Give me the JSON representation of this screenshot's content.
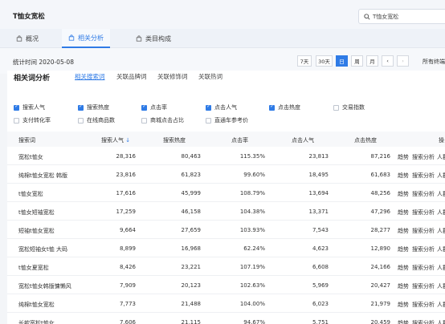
{
  "app": {
    "title": "T恤女宽松"
  },
  "search": {
    "value": "T恤女宽松"
  },
  "nav_tabs": [
    {
      "label": "概况",
      "icon": "shopping-bag-icon"
    },
    {
      "label": "相关分析",
      "icon": "shopping-bag-icon"
    },
    {
      "label": "类目构成",
      "icon": "shopping-bag-icon"
    }
  ],
  "stat": {
    "label": "统计时间 2020-05-08"
  },
  "date_buttons": [
    "7天",
    "30天",
    "日",
    "周",
    "月",
    "‹",
    "›"
  ],
  "all_terminals": "所有终端",
  "panel": {
    "title": "相关词分析",
    "subtabs": [
      "相关搜索词",
      "关联品牌词",
      "关联修饰词",
      "关联热词"
    ]
  },
  "options": [
    {
      "label": "搜索人气",
      "checked": true
    },
    {
      "label": "搜索热度",
      "checked": true
    },
    {
      "label": "点击率",
      "checked": true
    },
    {
      "label": "点击人气",
      "checked": true
    },
    {
      "label": "点击热度",
      "checked": true
    },
    {
      "label": "交易指数",
      "checked": false
    },
    {
      "label": "支付转化率",
      "checked": false
    },
    {
      "label": "在线商品数",
      "checked": false
    },
    {
      "label": "商城点击占比",
      "checked": false
    },
    {
      "label": "直通车参考价",
      "checked": false
    }
  ],
  "table": {
    "headers": [
      "搜索词",
      "搜索人气",
      "搜索热度",
      "点击率",
      "点击人气",
      "点击热度",
      "操"
    ],
    "sort_icon": "sort-down-icon",
    "actions": [
      "趋势",
      "搜索分析",
      "人群分"
    ],
    "rows": [
      [
        "宽松t恤女",
        "28,316",
        "80,463",
        "115.35%",
        "23,813",
        "87,216"
      ],
      [
        "纯棉t恤女宽松 韩版",
        "23,816",
        "61,823",
        "99.60%",
        "18,495",
        "61,683"
      ],
      [
        "t恤女宽松",
        "17,616",
        "45,999",
        "108.79%",
        "13,694",
        "48,256"
      ],
      [
        "t恤女短袖宽松",
        "17,259",
        "46,158",
        "104.38%",
        "13,371",
        "47,296"
      ],
      [
        "短袖t恤女宽松",
        "9,664",
        "27,659",
        "103.93%",
        "7,543",
        "28,277"
      ],
      [
        "宽松短袖女t恤 大码",
        "8,899",
        "16,968",
        "62.24%",
        "4,623",
        "12,890"
      ],
      [
        "t恤女夏宽松",
        "8,426",
        "23,221",
        "107.19%",
        "6,608",
        "24,166"
      ],
      [
        "宽松t恤女韩版慵懒风",
        "7,909",
        "20,123",
        "102.63%",
        "5,969",
        "20,427"
      ],
      [
        "纯棉t恤女宽松",
        "7,773",
        "21,488",
        "104.00%",
        "6,023",
        "21,979"
      ],
      [
        "长款宽松t恤女",
        "7,606",
        "21,115",
        "94.67%",
        "5,751",
        "20,459"
      ]
    ]
  }
}
